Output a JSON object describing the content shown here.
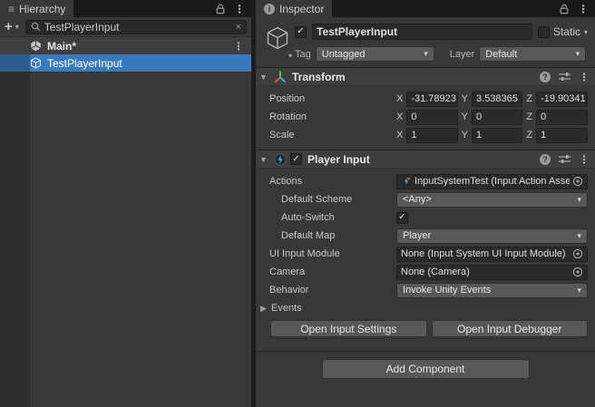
{
  "icons": {
    "menu": "⋮",
    "list": "≡",
    "plus": "+",
    "caret_down": "▾",
    "close": "×",
    "check": "✓",
    "help": "?",
    "info": "i",
    "foldout_open": "▼",
    "foldout_closed": "▶"
  },
  "colors": {
    "selection": "#3A79BC",
    "selection_gutter": "#2D5C8E",
    "panel": "#383838",
    "tabbar": "#191919",
    "field": "#2A2A2A",
    "control": "#585858",
    "component_header": "#3E3E3E"
  },
  "hierarchy": {
    "tab": "Hierarchy",
    "search_value": "TestPlayerInput",
    "scene": "Main*",
    "object": "TestPlayerInput"
  },
  "inspector": {
    "tab": "Inspector",
    "name": "TestPlayerInput",
    "static_label": "Static",
    "tag_label": "Tag",
    "tag_value": "Untagged",
    "layer_label": "Layer",
    "layer_value": "Default",
    "axes": [
      "X",
      "Y",
      "Z"
    ],
    "transform": {
      "title": "Transform",
      "position": {
        "label": "Position",
        "x": "-31.78923",
        "y": "3.538365",
        "z": "-19.90341"
      },
      "rotation": {
        "label": "Rotation",
        "x": "0",
        "y": "0",
        "z": "0"
      },
      "scale": {
        "label": "Scale",
        "x": "1",
        "y": "1",
        "z": "1"
      }
    },
    "player_input": {
      "title": "Player Input",
      "actions_label": "Actions",
      "actions_value": "InputSystemTest (Input Action Asset)",
      "default_scheme_label": "Default Scheme",
      "default_scheme_value": "<Any>",
      "auto_switch_label": "Auto-Switch",
      "default_map_label": "Default Map",
      "default_map_value": "Player",
      "ui_input_module_label": "UI Input Module",
      "ui_input_module_value": "None (Input System UI Input Module)",
      "camera_label": "Camera",
      "camera_value": "None (Camera)",
      "behavior_label": "Behavior",
      "behavior_value": "Invoke Unity Events",
      "events_label": "Events",
      "open_settings": "Open Input Settings",
      "open_debugger": "Open Input Debugger"
    },
    "add_component": "Add Component"
  }
}
